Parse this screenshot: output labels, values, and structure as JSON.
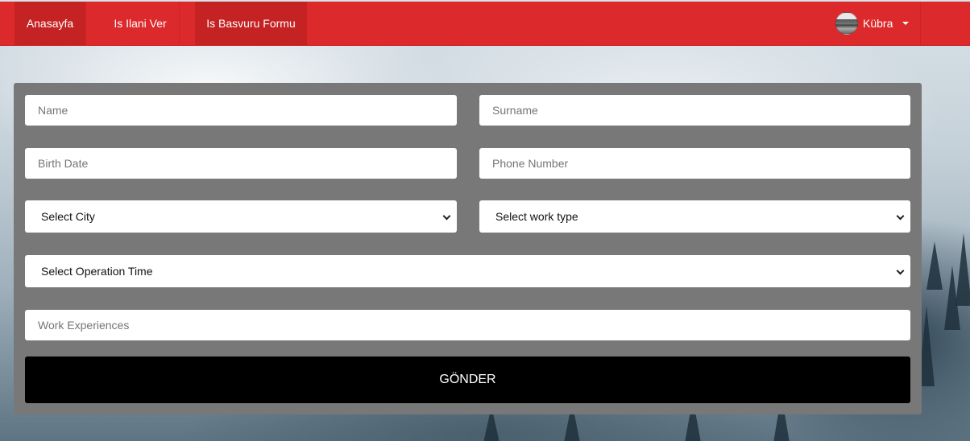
{
  "nav": {
    "items": [
      {
        "label": "Anasayfa",
        "active": true
      },
      {
        "label": "Is Ilani Ver",
        "active": false
      },
      {
        "label": "Is Basvuru Formu",
        "active": true
      }
    ],
    "user": {
      "name": "Kübra"
    },
    "color": "#dc292b"
  },
  "form": {
    "name_placeholder": "Name",
    "surname_placeholder": "Surname",
    "birth_date_placeholder": "Birth Date",
    "phone_placeholder": "Phone Number",
    "city_select": "Select City",
    "work_type_select": "Select work type",
    "operation_time_select": "Select Operation Time",
    "experiences_placeholder": "Work Experiences",
    "submit_label": "GÖNDER",
    "panel_color": "#787878"
  }
}
